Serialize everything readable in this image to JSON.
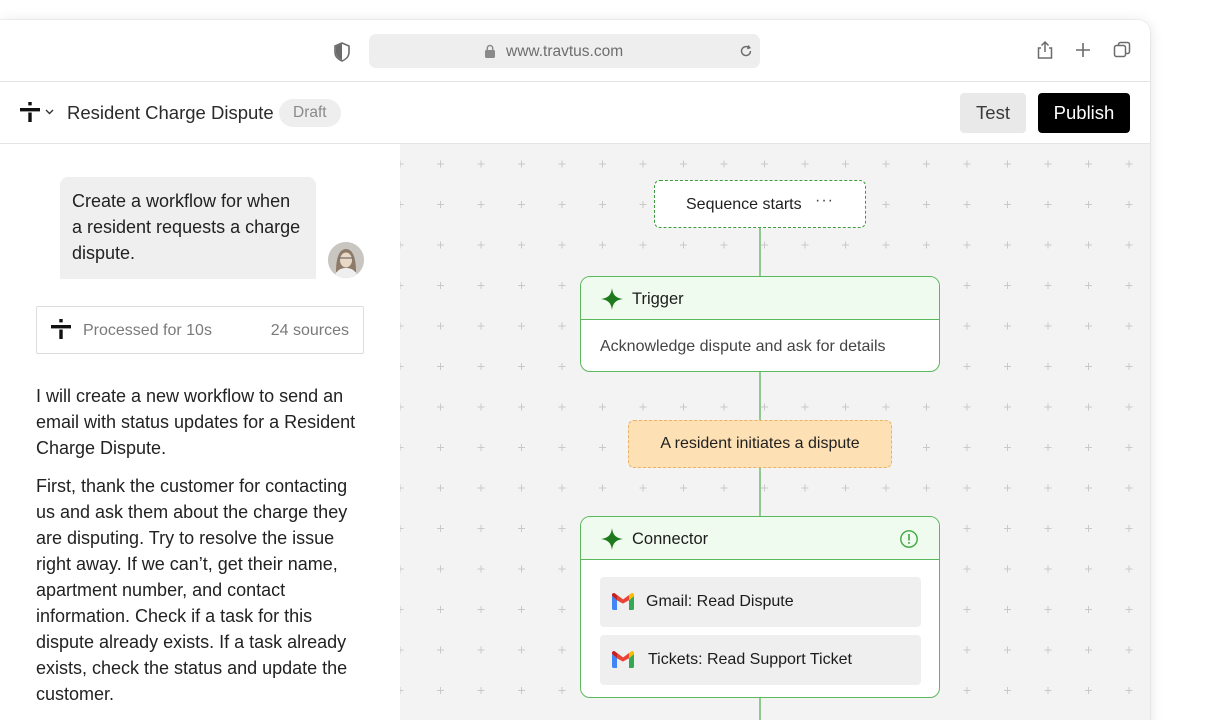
{
  "browser": {
    "url": "www.travtus.com",
    "icons": [
      "shield-icon",
      "lock-icon",
      "reload-icon",
      "share-icon",
      "new-tab-icon",
      "tabs-icon"
    ]
  },
  "header": {
    "title": "Resident Charge Dispute",
    "status_badge": "Draft",
    "test_label": "Test",
    "publish_label": "Publish"
  },
  "chat": {
    "user_message": "Create a workflow for when a resident requests a charge dispute.",
    "process": {
      "status": "Processed for 10s",
      "sources": "24 sources"
    },
    "reply_paragraphs": [
      "I will create a new workflow to send an email with status updates for a Resident Charge Dispute.",
      "First, thank the customer for contacting us and ask them about the charge they are disputing. Try to resolve the issue right away. If we can’t, get their name, apartment number, and contact information. Check if a task for this dispute already exists. If a task already exists, check the status and update the customer."
    ]
  },
  "canvas": {
    "start_node": {
      "label": "Sequence starts",
      "more": "···"
    },
    "trigger_node": {
      "title": "Trigger",
      "description": "Acknowledge dispute and ask for details"
    },
    "event_node": {
      "label": "A resident initiates a dispute"
    },
    "connector_node": {
      "title": "Connector",
      "items": [
        {
          "label": "Gmail: Read Dispute",
          "icon": "gmail-icon"
        },
        {
          "label": "Tickets: Read Support Ticket",
          "icon": "gmail-icon"
        }
      ]
    },
    "colors": {
      "accent_green": "#5cb85c",
      "node_head_bg": "#f0fbef",
      "event_bg": "#fde1b4",
      "canvas_bg": "#f3f3f3"
    }
  }
}
